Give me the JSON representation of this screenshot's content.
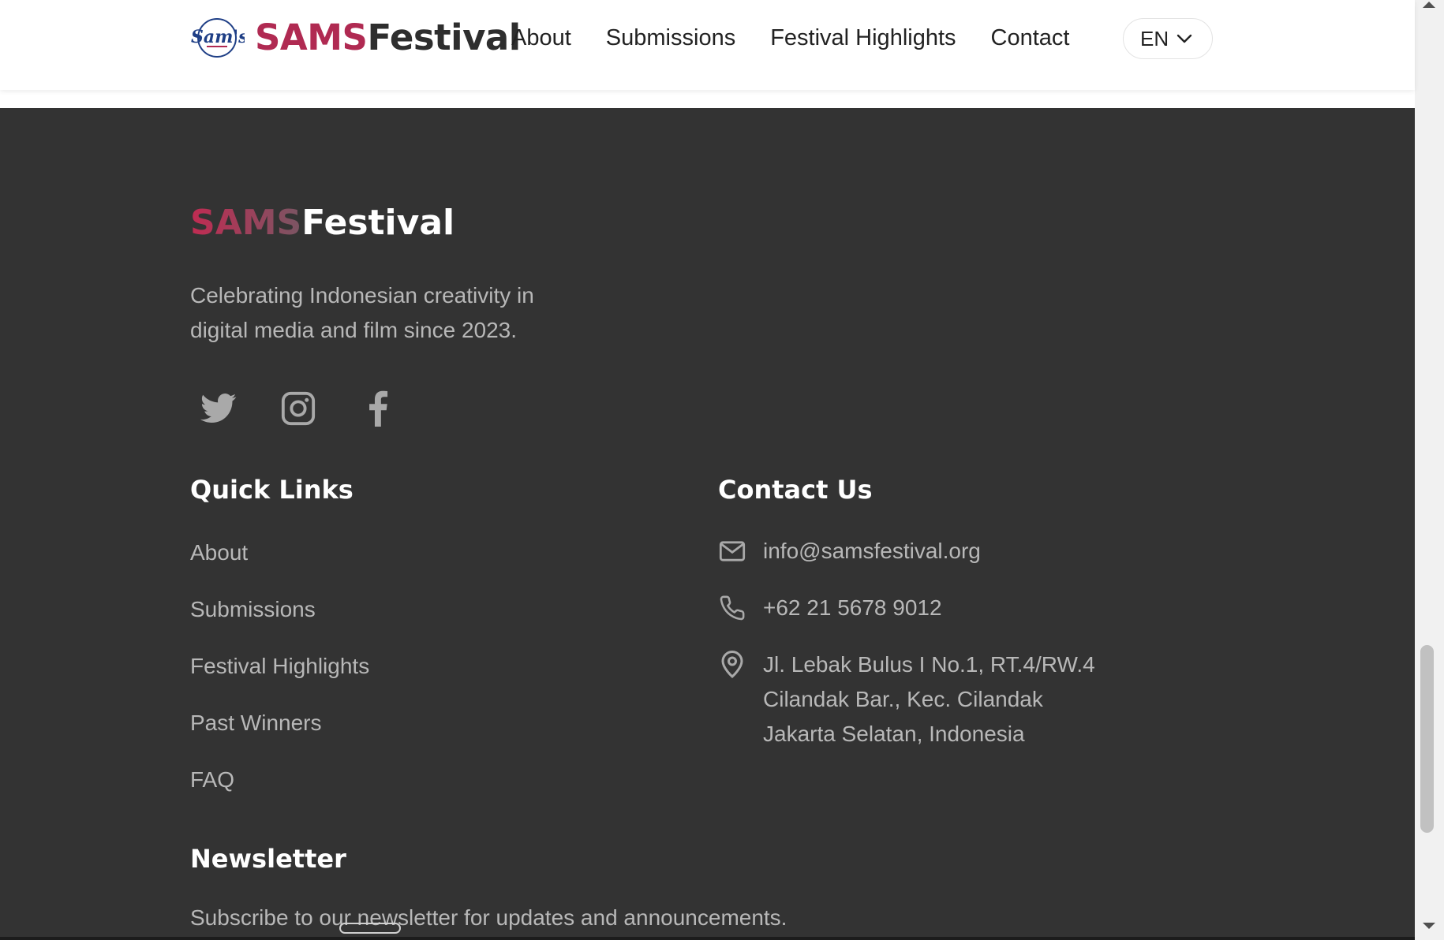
{
  "header": {
    "logo_alt": "Sam's Studios",
    "brand_part1": "SAMS",
    "brand_part2": "Festival",
    "nav": [
      "About",
      "Submissions",
      "Festival Highlights",
      "Contact"
    ],
    "language": "EN"
  },
  "footer": {
    "brand_part1": "SAMS",
    "brand_part2": "Festival",
    "tagline_line1": "Celebrating Indonesian creativity in",
    "tagline_line2": "digital media and film since 2023.",
    "social": [
      "twitter-icon",
      "instagram-icon",
      "facebook-icon"
    ],
    "quick_links": {
      "title": "Quick Links",
      "items": [
        "About",
        "Submissions",
        "Festival Highlights",
        "Past Winners",
        "FAQ"
      ]
    },
    "contact": {
      "title": "Contact Us",
      "email": "info@samsfestival.org",
      "phone": "+62 21 5678 9012",
      "address_line1": "Jl. Lebak Bulus I No.1, RT.4/RW.4",
      "address_line2": "Cilandak Bar., Kec. Cilandak",
      "address_line3": "Jakarta Selatan, Indonesia"
    },
    "newsletter": {
      "title": "Newsletter",
      "text": "Subscribe to our newsletter for updates and announcements."
    }
  },
  "colors": {
    "brand_accent": "#b02a52",
    "footer_bg": "#333333",
    "footer_text": "#b8b8b8"
  }
}
